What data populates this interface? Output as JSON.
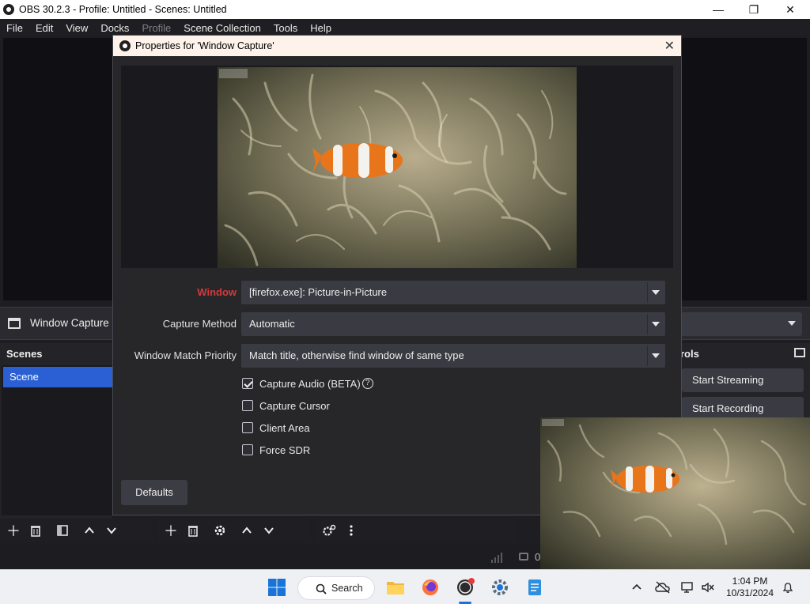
{
  "window": {
    "title": "OBS 30.2.3 - Profile: Untitled - Scenes: Untitled",
    "minimize": "—",
    "maximize": "❐",
    "close": "✕"
  },
  "menu": {
    "file": "File",
    "edit": "Edit",
    "view": "View",
    "docks": "Docks",
    "profile": "Profile",
    "scene_collection": "Scene Collection",
    "tools": "Tools",
    "help": "Help"
  },
  "source_bar": {
    "source_name": "Window Capture"
  },
  "scenes": {
    "title": "Scenes",
    "items": [
      "Scene"
    ]
  },
  "controls": {
    "title": "rols",
    "start_streaming": "Start Streaming",
    "start_recording": "Start Recording"
  },
  "dialog": {
    "title": "Properties for 'Window Capture'",
    "close": "✕",
    "fields": {
      "window_label": "Window",
      "window_value": "[firefox.exe]: Picture-in-Picture",
      "capture_method_label": "Capture Method",
      "capture_method_value": "Automatic",
      "match_priority_label": "Window Match Priority",
      "match_priority_value": "Match title, otherwise find window of same type"
    },
    "checkboxes": [
      {
        "label": "Capture Audio (BETA)",
        "checked": true
      },
      {
        "label": "Capture Cursor",
        "checked": false
      },
      {
        "label": "Client Area",
        "checked": false
      },
      {
        "label": "Force SDR",
        "checked": false
      }
    ],
    "help_glyph": "?",
    "defaults_button": "Defaults"
  },
  "status": {
    "value": "0"
  },
  "taskbar": {
    "search": "Search",
    "time": "1:04 PM",
    "date": "10/31/2024"
  },
  "colors": {
    "accent_blue": "#2a60d3",
    "warning_red": "#d43a3a",
    "dialog_bg": "#272729",
    "fish_orange": "#e8751a"
  }
}
